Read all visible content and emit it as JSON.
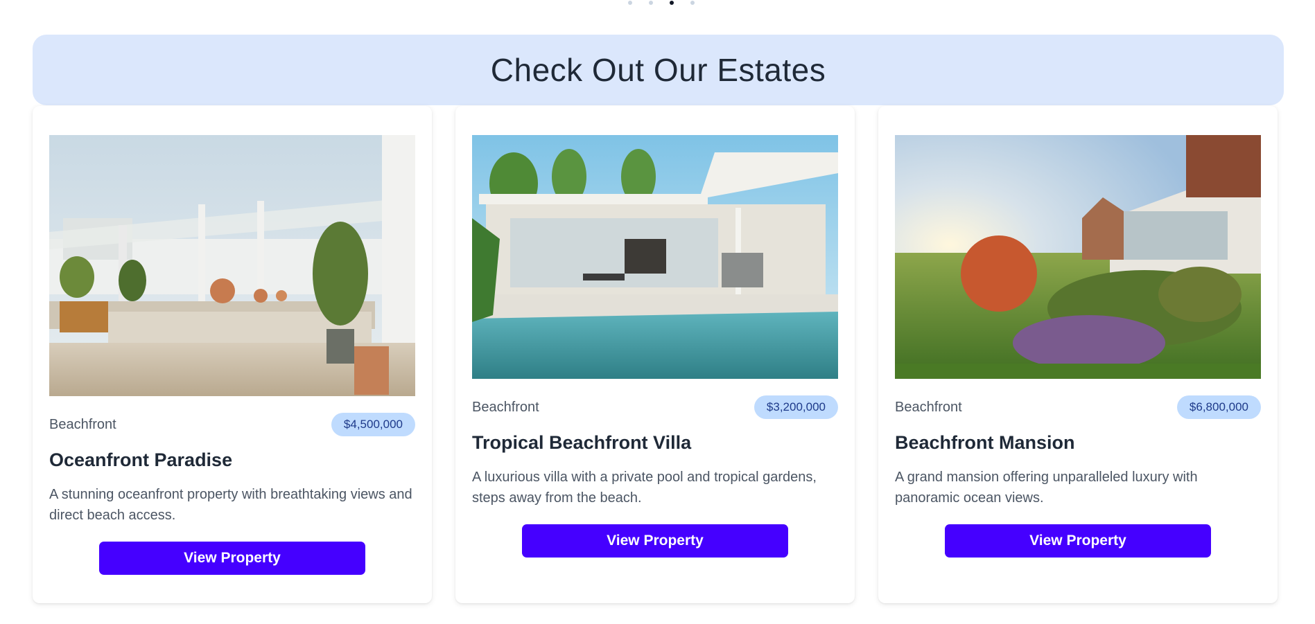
{
  "carousel": {
    "dot_count": 4,
    "active_index": 2
  },
  "banner": {
    "title": "Check Out Our Estates"
  },
  "colors": {
    "banner_bg": "#dbe7fc",
    "button_bg": "#4500ff",
    "badge_bg": "#bfdbfe",
    "badge_text": "#1e3a8a"
  },
  "properties": [
    {
      "image_alt": "patio-with-glass-pergola",
      "category": "Beachfront",
      "price": "$4,500,000",
      "title": "Oceanfront Paradise",
      "description": "A stunning oceanfront property with breathtaking views and direct beach access.",
      "button_label": "View Property"
    },
    {
      "image_alt": "modern-villa-with-pool",
      "category": "Beachfront",
      "price": "$3,200,000",
      "title": "Tropical Beachfront Villa",
      "description": "A luxurious villa with a private pool and tropical gardens, steps away from the beach.",
      "button_label": "View Property"
    },
    {
      "image_alt": "mansion-with-garden-at-sunset",
      "category": "Beachfront",
      "price": "$6,800,000",
      "title": "Beachfront Mansion",
      "description": "A grand mansion offering unparalleled luxury with panoramic ocean views.",
      "button_label": "View Property"
    }
  ]
}
